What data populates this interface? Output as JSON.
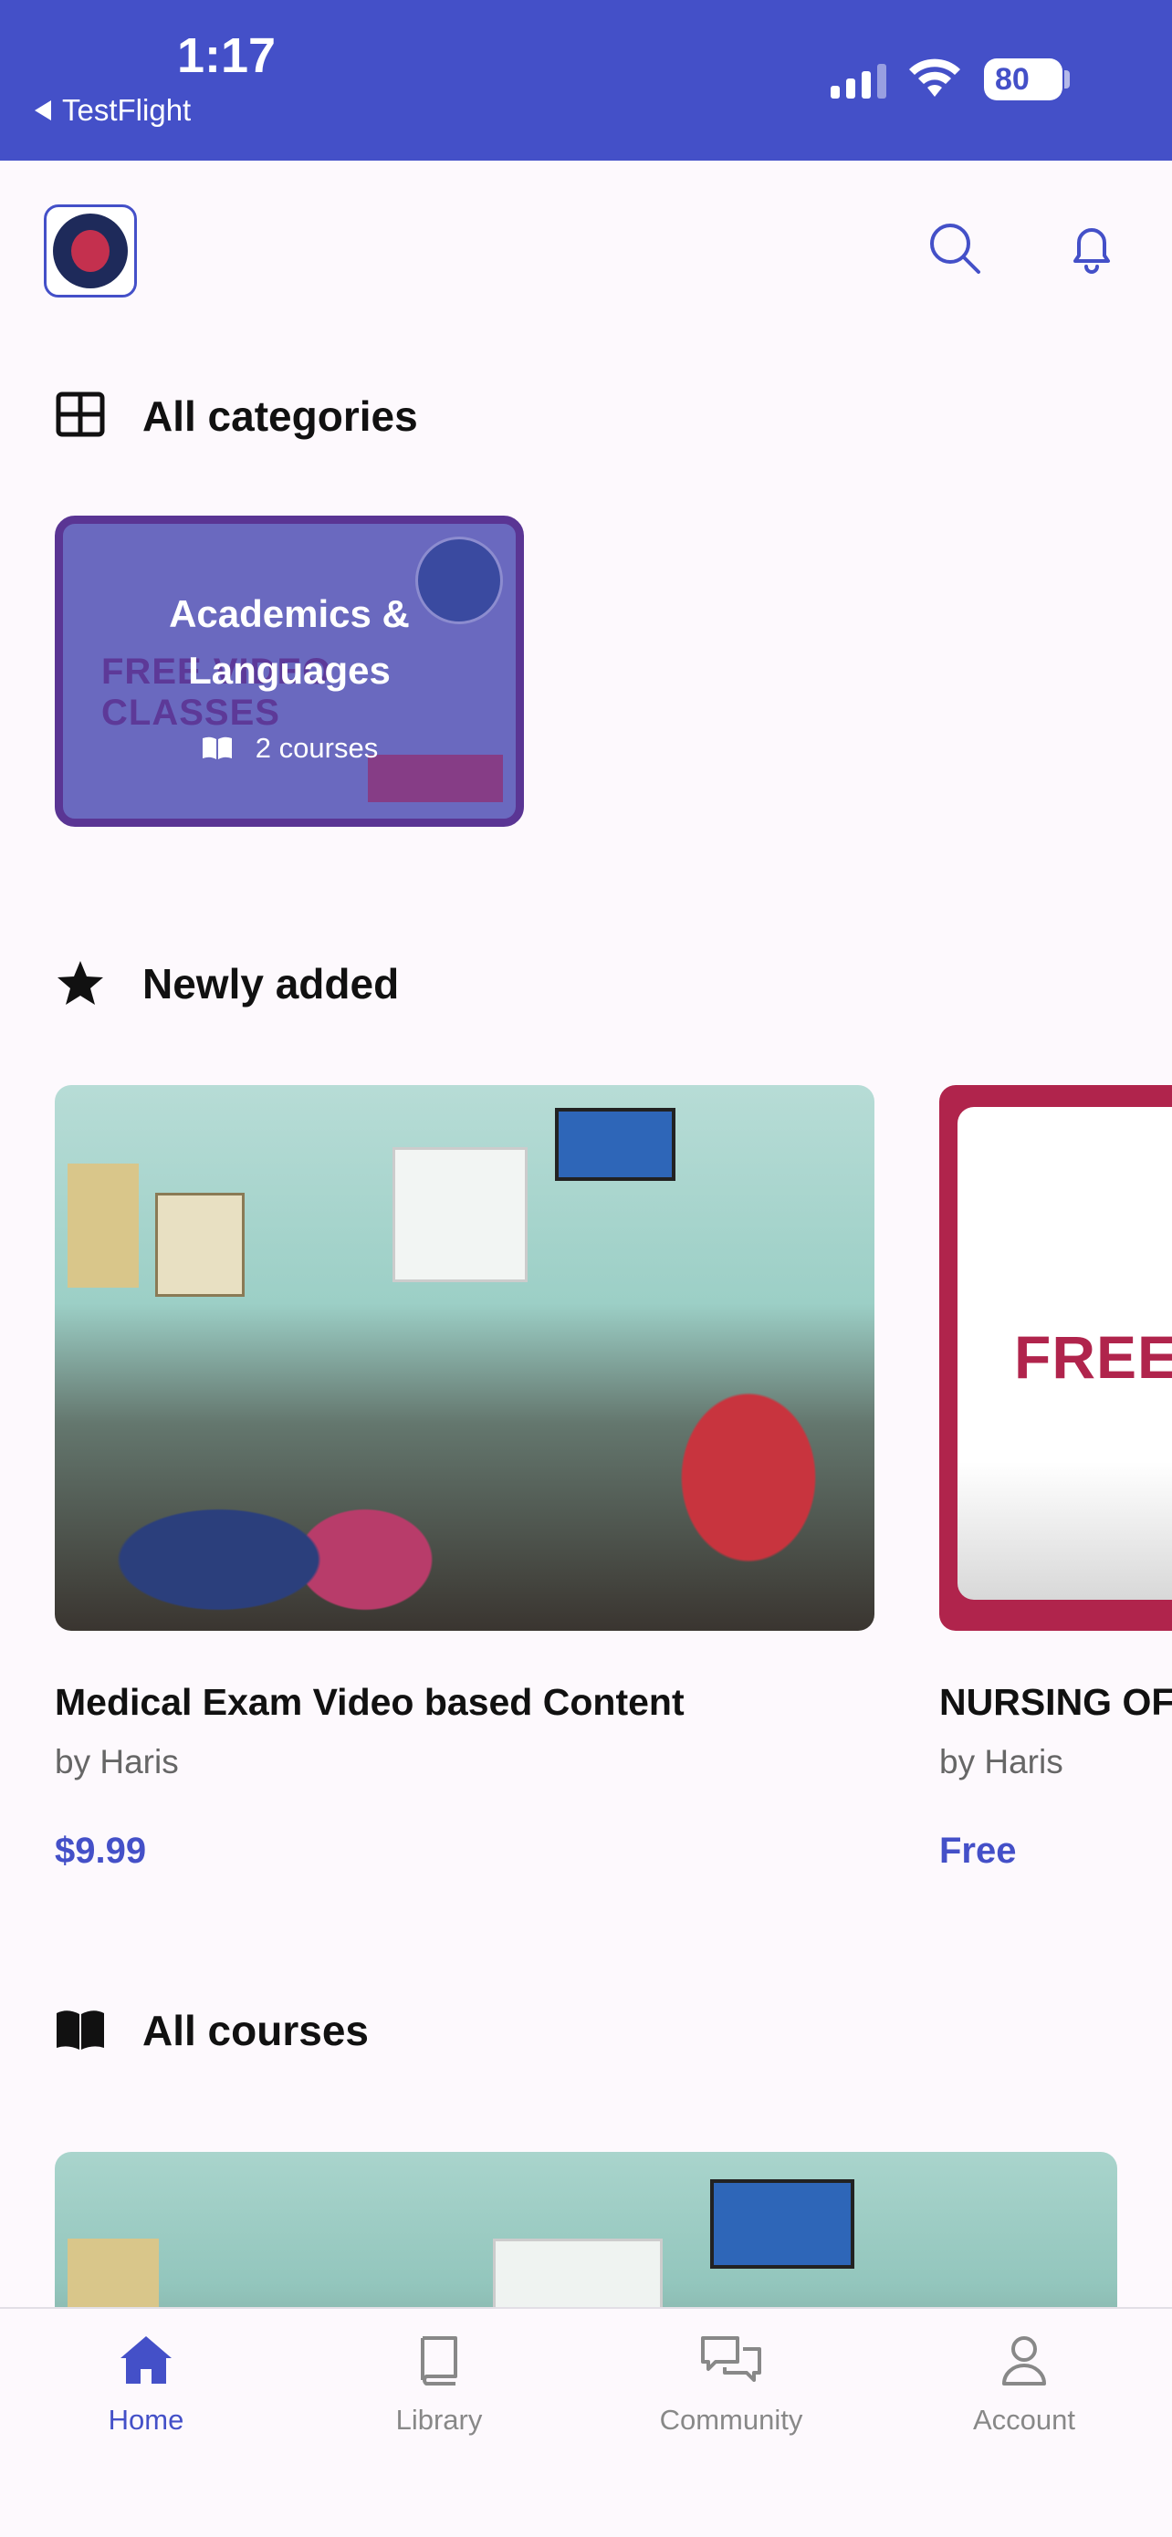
{
  "status_bar": {
    "time": "1:17",
    "back_app": "TestFlight",
    "battery": "80"
  },
  "header": {
    "logo_icon": "academy-logo",
    "search_icon": "search-icon",
    "bell_icon": "bell-icon"
  },
  "categories_section": {
    "title": "All categories",
    "icon": "grid-icon",
    "items": [
      {
        "title": "Academics & Languages",
        "count_label": "2 courses",
        "background_text": "FREE VIDEO CLASSES"
      }
    ]
  },
  "newly_added": {
    "title": "Newly added",
    "icon": "star-icon",
    "items": [
      {
        "title": "Medical Exam Video based Content",
        "author": "by Haris",
        "price": "$9.99"
      },
      {
        "title": "NURSING OF",
        "author": "by Haris",
        "price": "Free",
        "image_text": "FREE"
      }
    ]
  },
  "all_courses": {
    "title": "All courses",
    "icon": "open-book-icon"
  },
  "bottom_nav": {
    "items": [
      {
        "label": "Home",
        "icon": "home-icon",
        "active": true
      },
      {
        "label": "Library",
        "icon": "library-icon",
        "active": false
      },
      {
        "label": "Community",
        "icon": "chat-bubbles-icon",
        "active": false
      },
      {
        "label": "Account",
        "icon": "user-icon",
        "active": false
      }
    ]
  },
  "colors": {
    "accent": "#4450c8",
    "background": "#fdf9fd",
    "category_card": "#6a69bf",
    "category_border": "#5a3594",
    "free_card": "#b0244c"
  }
}
